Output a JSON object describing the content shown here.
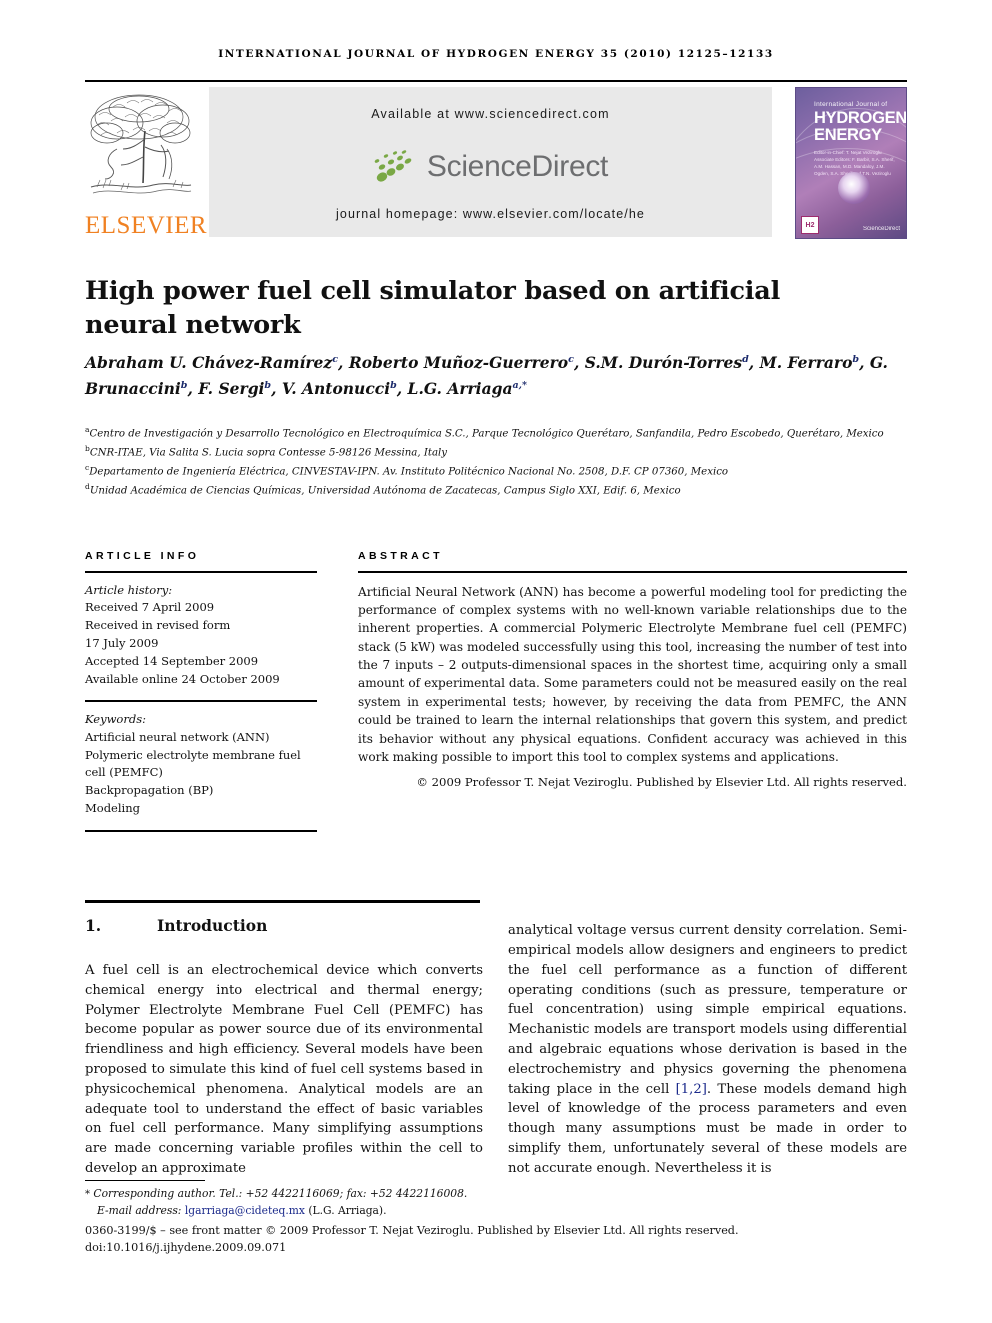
{
  "running_head": "INTERNATIONAL JOURNAL OF HYDROGEN ENERGY 35 (2010) 12125–12133",
  "masthead": {
    "publisher_name": "ELSEVIER",
    "available_at": "Available at www.sciencedirect.com",
    "sciencedirect_word": "ScienceDirect",
    "journal_homepage": "journal homepage: www.elsevier.com/locate/he",
    "cover": {
      "line1": "International Journal of",
      "line2": "HYDROGEN",
      "line3": "ENERGY",
      "editors": "Editor-in-Chief: T. Nejat Veziroglu    Associate Editors: F. Barbir, S.A. Sherif, A.M. Hassan, M.D. Mandaloy, J.M. Ogden, S.A. Sherif and T.N. Veziroglu",
      "badge": "H2",
      "sciencedirect_footer": "ScienceDirect"
    }
  },
  "title": "High power fuel cell simulator based on artificial neural network",
  "authors": [
    {
      "name": "Abraham U. Chávez-Ramírez",
      "sup": "c",
      "sep": ", "
    },
    {
      "name": "Roberto Muñoz-Guerrero",
      "sup": "c",
      "sep": ", "
    },
    {
      "name": "S.M. Durón-Torres",
      "sup": "d",
      "sep": ", "
    },
    {
      "name": "M. Ferraro",
      "sup": "b",
      "sep": ", "
    },
    {
      "name": "G. Brunaccini",
      "sup": "b",
      "sep": ", "
    },
    {
      "name": "F. Sergi",
      "sup": "b",
      "sep": ", "
    },
    {
      "name": "V. Antonucci",
      "sup": "b",
      "sep": ", "
    },
    {
      "name": "L.G. Arriaga",
      "sup": "a,*",
      "sep": ""
    }
  ],
  "affiliations": [
    {
      "label": "a",
      "text": "Centro de Investigación y Desarrollo Tecnológico en Electroquímica S.C., Parque Tecnológico Querétaro, Sanfandila, Pedro Escobedo, Querétaro, Mexico"
    },
    {
      "label": "b",
      "text": "CNR-ITAE, Via Salita S. Lucia sopra Contesse 5-98126 Messina, Italy"
    },
    {
      "label": "c",
      "text": "Departamento de Ingeniería Eléctrica, CINVESTAV-IPN. Av. Instituto Politécnico Nacional No. 2508, D.F. CP 07360, Mexico"
    },
    {
      "label": "d",
      "text": "Unidad Académica de Ciencias Químicas, Universidad Autónoma de Zacatecas, Campus Siglo XXI, Edif. 6, Mexico"
    }
  ],
  "article_info": {
    "heading": "ARTICLE INFO",
    "history_label": "Article history:",
    "history": [
      "Received 7 April 2009",
      "Received in revised form",
      "17 July 2009",
      "Accepted 14 September 2009",
      "Available online 24 October 2009"
    ],
    "keywords_label": "Keywords:",
    "keywords": [
      "Artificial neural network (ANN)",
      "Polymeric electrolyte membrane fuel cell (PEMFC)",
      "Backpropagation (BP)",
      "Modeling"
    ]
  },
  "abstract": {
    "heading": "ABSTRACT",
    "text": "Artificial Neural Network (ANN) has become a powerful modeling tool for predicting the performance of complex systems with no well-known variable relationships due to the inherent properties. A commercial Polymeric Electrolyte Membrane fuel cell (PEMFC) stack (5 kW) was modeled successfully using this tool, increasing the number of test into the 7 inputs – 2 outputs-dimensional spaces in the shortest time, acquiring only a small amount of experimental data. Some parameters could not be measured easily on the real system in experimental tests; however, by receiving the data from PEMFC, the ANN could be trained to learn the internal relationships that govern this system, and predict its behavior without any physical equations. Confident accuracy was achieved in this work making possible to import this tool to complex systems and applications.",
    "copyright": "© 2009 Professor T. Nejat Veziroglu. Published by Elsevier Ltd. All rights reserved."
  },
  "introduction": {
    "number": "1.",
    "heading": "Introduction",
    "left_paragraph": "A fuel cell is an electrochemical device which converts chemical energy into electrical and thermal energy; Polymer Electrolyte Membrane Fuel Cell (PEMFC) has become popular as power source due of its environmental friendliness and high efficiency. Several models have been proposed to simulate this kind of fuel cell systems based in physicochemical phenomena. Analytical models are an adequate tool to understand the effect of basic variables on fuel cell performance. Many simplifying assumptions are made concerning variable profiles within the cell to develop an approximate",
    "right_paragraph_part1": "analytical voltage versus current density correlation. Semi-empirical models allow designers and engineers to predict the fuel cell performance as a function of different operating conditions (such as pressure, temperature or fuel concentration) using simple empirical equations. Mechanistic models are transport models using differential and algebraic equations whose derivation is based in the electrochemistry and physics governing the phenomena taking place in the cell ",
    "right_citation": "[1,2]",
    "right_paragraph_part2": ". These models demand high level of knowledge of the process parameters and even though many assumptions must be made in order to simplify them, unfortunately several of these models are not accurate enough. Nevertheless it is"
  },
  "footnote": {
    "marker": "*",
    "corresponding": "Corresponding author. Tel.: +52 4422116069; fax: +52 4422116008.",
    "email_label": "E-mail address:",
    "email": "lgarriaga@cideteq.mx",
    "email_owner": "(L.G. Arriaga)."
  },
  "imprint": {
    "line1": "0360-3199/$ – see front matter © 2009 Professor T. Nejat Veziroglu. Published by Elsevier Ltd. All rights reserved.",
    "line2": "doi:10.1016/j.ijhydene.2009.09.071"
  },
  "colors": {
    "elsevier_orange": "#F08122",
    "sciencedirect_green": "#7AA845",
    "sciencedirect_gray": "#6D6E70",
    "link_blue": "#1b2a8b",
    "superscript_navy": "#1b2a6b"
  }
}
